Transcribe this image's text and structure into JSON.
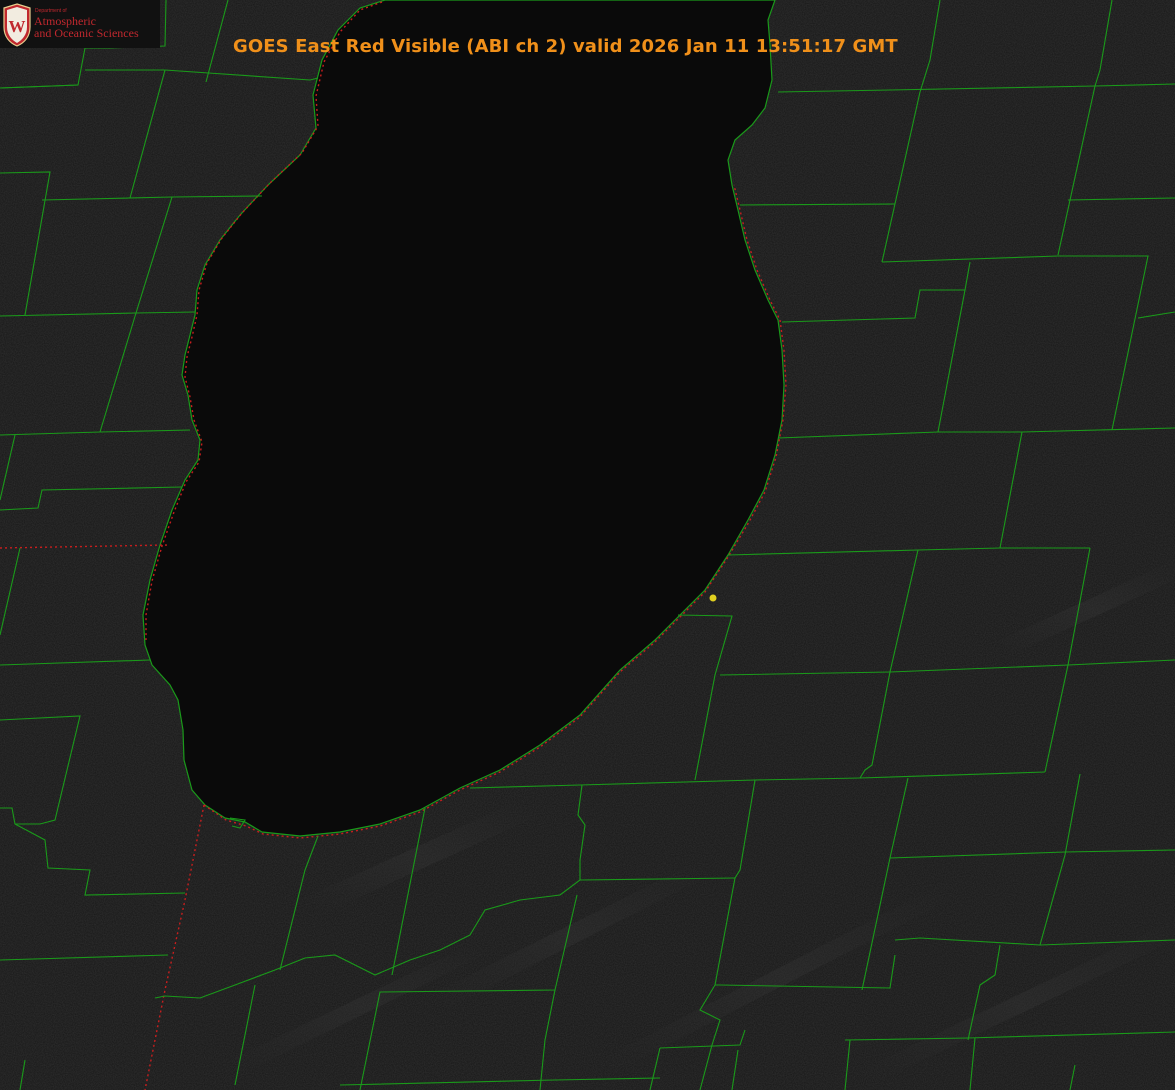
{
  "title": "GOES East Red Visible (ABI ch 2) valid 2026 Jan 11 13:51:17 GMT",
  "logo": {
    "department": "Department of",
    "line1": "Atmospheric",
    "line2": "and Oceanic Sciences"
  },
  "colors": {
    "title": "#f0901a",
    "county_lines": "#1a9a1a",
    "state_border": "#c81e1e",
    "marker": "#e0d020",
    "background": "#0d0d0d",
    "lake": "#0a0a0a",
    "logo_red": "#c0282e"
  },
  "marker": {
    "name": "station-marker-icon"
  }
}
